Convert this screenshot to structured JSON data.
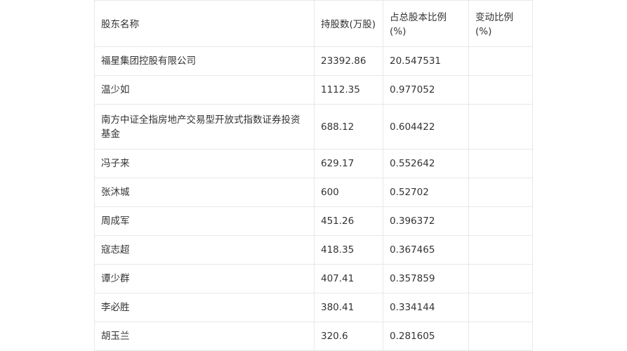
{
  "table": {
    "headers": [
      "股东名称",
      "持股数(万股)",
      "占总股本比例(%)",
      "变动比例(%)"
    ],
    "rows": [
      {
        "name": "福星集团控股有限公司",
        "shares": "23392.86",
        "ratio": "20.547531",
        "change": ""
      },
      {
        "name": "温少如",
        "shares": "1112.35",
        "ratio": "0.977052",
        "change": ""
      },
      {
        "name": "南方中证全指房地产交易型开放式指数证券投资基金",
        "shares": "688.12",
        "ratio": "0.604422",
        "change": ""
      },
      {
        "name": "冯子来",
        "shares": "629.17",
        "ratio": "0.552642",
        "change": ""
      },
      {
        "name": "张沐城",
        "shares": "600",
        "ratio": "0.52702",
        "change": ""
      },
      {
        "name": "周成军",
        "shares": "451.26",
        "ratio": "0.396372",
        "change": ""
      },
      {
        "name": "寇志超",
        "shares": "418.35",
        "ratio": "0.367465",
        "change": ""
      },
      {
        "name": "谭少群",
        "shares": "407.41",
        "ratio": "0.357859",
        "change": ""
      },
      {
        "name": "李必胜",
        "shares": "380.41",
        "ratio": "0.334144",
        "change": ""
      },
      {
        "name": "胡玉兰",
        "shares": "320.6",
        "ratio": "0.281605",
        "change": ""
      }
    ]
  }
}
